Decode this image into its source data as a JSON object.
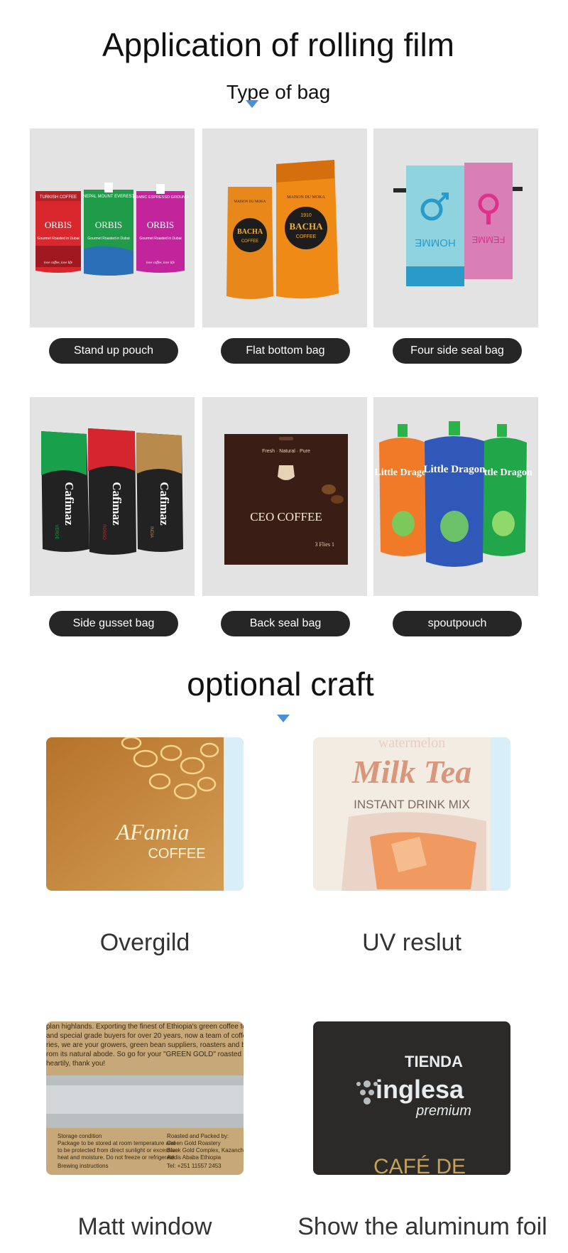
{
  "header": {
    "title": "Application of rolling film",
    "subtitle": "Type of bag"
  },
  "bag_types": [
    {
      "label": "Stand up pouch",
      "icon": "stand-up-pouch-image"
    },
    {
      "label": "Flat bottom bag",
      "icon": "flat-bottom-bag-image"
    },
    {
      "label": "Four side seal bag",
      "icon": "four-side-seal-bag-image"
    },
    {
      "label": "Side gusset bag",
      "icon": "side-gusset-bag-image"
    },
    {
      "label": "Back seal bag",
      "icon": "back-seal-bag-image"
    },
    {
      "label": "spoutpouch",
      "icon": "spout-pouch-image"
    }
  ],
  "product_art": {
    "orbis": {
      "brand": "ORBIS",
      "variants": [
        "TURKISH COFFEE",
        "NEPAL MOUNT EVEREST",
        "ARABIC ESPRESSO GROUND"
      ],
      "tagline": "Gourmet Roasted in Dubai",
      "script": "love coffee, love life"
    },
    "bacha": {
      "brand": "BACHA",
      "sub": "COFFEE",
      "year": "1910",
      "top": "MAISON DU MOKA"
    },
    "homme_femme": {
      "left": "HOMME",
      "right": "FEMME"
    },
    "carimaz": {
      "brand": "Cafimaz",
      "variants": [
        "VERDE",
        "ROSSO",
        "INDIA"
      ]
    },
    "ceo": {
      "brand": "CEO COFFEE",
      "tagline": "Fresh · Natural · Pure",
      "note": "3 Flies 1"
    },
    "little_dragon": {
      "brand": "Little Dragon"
    }
  },
  "craft": {
    "title": "optional craft",
    "items": [
      {
        "label": "Overgild",
        "art": "AFamia",
        "art_sub": "COFFEE"
      },
      {
        "label": "UV reslut",
        "art": "Milk Tea",
        "art_sub": "INSTANT DRINK MIX",
        "art_top": "watermelon"
      },
      {
        "label": "Matt window",
        "text_lines": [
          "plan highlands. Exporting the finest of Ethiopia's green coffee to",
          "and special grade buyers for over 20 years, now a team of coffee",
          "ries, we are your growers, green bean suppliers, roasters and ba",
          "rom its natural abode. So go for your \"GREEN GOLD\" roasted coffe",
          "heartily, thank you!"
        ],
        "bottom_left": [
          "Storage condition",
          "Package to be stored at room temperature and",
          "to be protected from direct sunlight or excessive",
          "heat and moisture. Do not freeze or refrigerate",
          "Brewing instructions"
        ],
        "bottom_right": [
          "Roasted and Packed by:",
          "Green Gold Roastery",
          "Black Gold Complex, Kazanchis",
          "Addis Ababa Ethiopia",
          "Tel: +251 11557 2453"
        ]
      },
      {
        "label": "Show the aluminum foil",
        "art": "TIENDA",
        "art_main": "inglesa",
        "art_sub": "premium",
        "art_bottom": "CAFÉ DE"
      }
    ]
  },
  "colors": {
    "marker": "#4a90d9",
    "pill": "#262626",
    "tile_bg": "#e3e3e3"
  }
}
